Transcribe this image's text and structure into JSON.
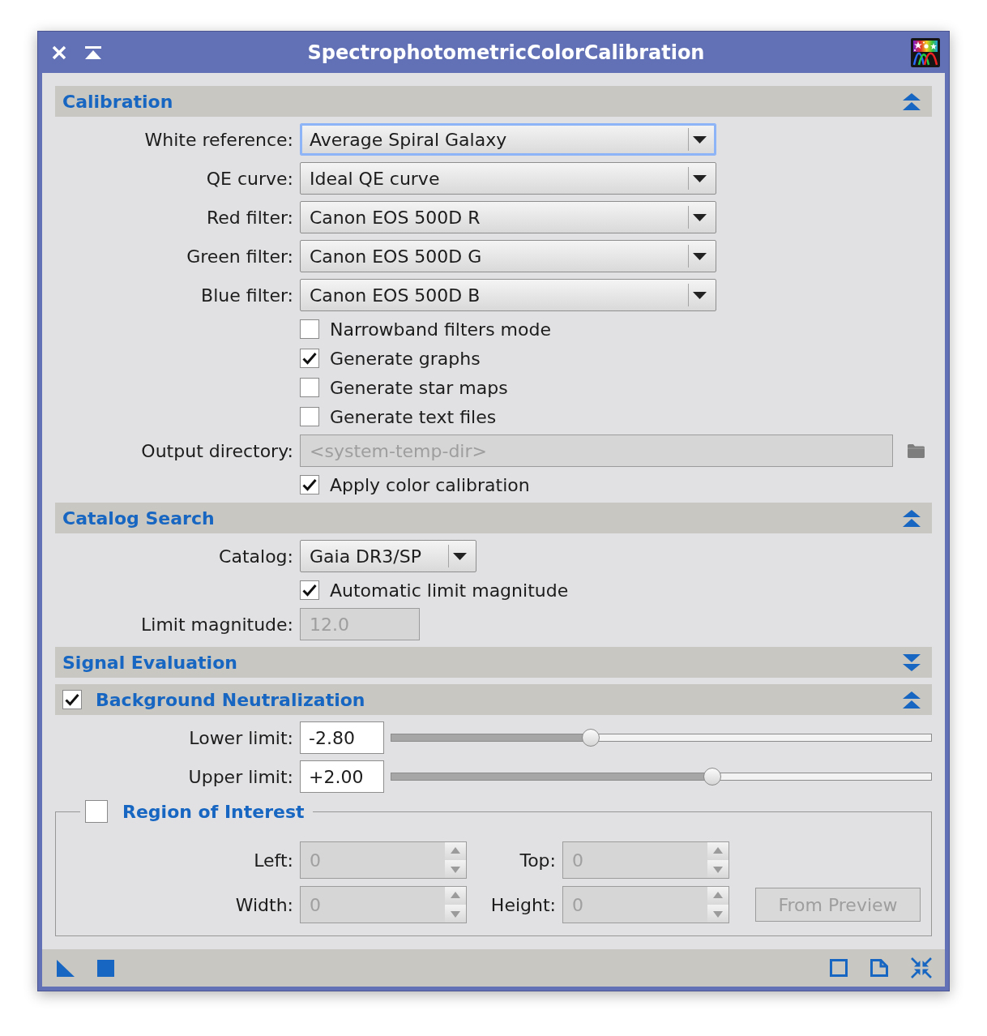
{
  "window": {
    "title": "SpectrophotometricColorCalibration"
  },
  "sections": [
    {
      "title": "Calibration",
      "expanded": true,
      "rows": [
        {
          "kind": "combo",
          "label": "White reference:",
          "value": "Average Spiral Galaxy",
          "focused": true
        },
        {
          "kind": "combo",
          "label": "QE curve:",
          "value": "Ideal QE curve",
          "focused": false
        },
        {
          "kind": "combo",
          "label": "Red filter:",
          "value": "Canon EOS 500D R",
          "focused": false
        },
        {
          "kind": "combo",
          "label": "Green filter:",
          "value": "Canon EOS 500D G",
          "focused": false
        },
        {
          "kind": "combo",
          "label": "Blue filter:",
          "value": "Canon EOS 500D B",
          "focused": false
        },
        {
          "kind": "checkbox",
          "label": "Narrowband filters mode",
          "checked": false
        },
        {
          "kind": "checkbox",
          "label": "Generate graphs",
          "checked": true
        },
        {
          "kind": "checkbox",
          "label": "Generate star maps",
          "checked": false
        },
        {
          "kind": "checkbox",
          "label": "Generate text files",
          "checked": false
        },
        {
          "kind": "directory",
          "label": "Output directory:",
          "placeholder": "<system-temp-dir>",
          "disabled": true
        },
        {
          "kind": "checkbox",
          "label": "Apply color calibration",
          "checked": true
        }
      ]
    },
    {
      "title": "Catalog Search",
      "expanded": true,
      "rows": [
        {
          "kind": "small-combo",
          "label": "Catalog:",
          "value": "Gaia DR3/SP",
          "focused": false
        },
        {
          "kind": "checkbox",
          "label": "Automatic limit magnitude",
          "checked": true
        },
        {
          "kind": "number",
          "label": "Limit magnitude:",
          "value": "12.0",
          "disabled": true
        }
      ]
    },
    {
      "title": "Signal Evaluation",
      "expanded": false
    },
    {
      "title": "Background Neutralization",
      "checked": true,
      "expanded": true,
      "rows": [
        {
          "kind": "slider",
          "label": "Lower limit:",
          "value": "-2.80",
          "level": 0.37
        },
        {
          "kind": "slider",
          "label": "Upper limit:",
          "value": "+2.00",
          "level": 0.594
        },
        {
          "kind": "group",
          "title": "Region of Interest",
          "checked": false,
          "fields": [
            {
              "label": "Left:",
              "value": "0",
              "disabled": true
            },
            {
              "label": "Top:",
              "value": "0",
              "disabled": true
            },
            {
              "label": "Width:",
              "value": "0",
              "disabled": true
            },
            {
              "label": "Height:",
              "value": "0",
              "disabled": true
            }
          ],
          "button": {
            "label": "From Preview",
            "disabled": true
          }
        }
      ]
    }
  ]
}
